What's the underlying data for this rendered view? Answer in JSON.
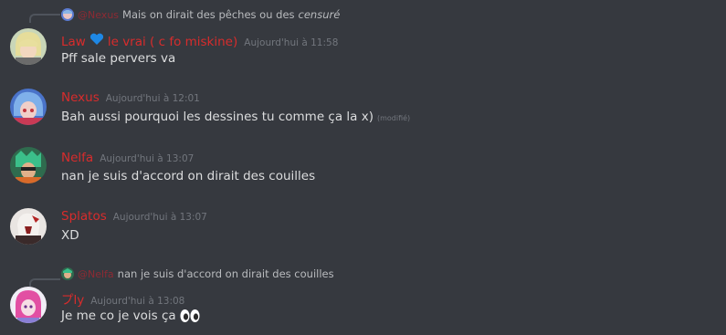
{
  "messages": [
    {
      "reply": {
        "name": "@Nexus",
        "text": "Mais on dirait des pêches ou des",
        "italic": "censuré"
      },
      "username_pre": "Law",
      "username_post": "le vrai ( c fo miskine)",
      "timestamp": "Aujourd'hui à 11:58",
      "text": "Pff sale pervers va"
    },
    {
      "username": "Nexus",
      "timestamp": "Aujourd'hui à 12:01",
      "text": "Bah aussi pourquoi les dessines tu comme ça la x)",
      "edited": "(modifié)"
    },
    {
      "username": "Nelfa",
      "timestamp": "Aujourd'hui à 13:07",
      "text": "nan je suis d'accord on dirait des couilles"
    },
    {
      "username": "Splatos",
      "timestamp": "Aujourd'hui à 13:07",
      "text": "XD"
    },
    {
      "reply": {
        "name": "@Nelfa",
        "text": "nan je suis d'accord on dirait des couilles"
      },
      "username": "プly",
      "timestamp": "Aujourd'hui à 13:08",
      "text": "Je me co je vois ça",
      "emoji": "eyes-emoji"
    }
  ],
  "colors": {
    "background": "#36393f",
    "username": "#d82c2c",
    "timestamp": "#72767d",
    "text": "#dcddde",
    "heart": "#1e88e5"
  }
}
